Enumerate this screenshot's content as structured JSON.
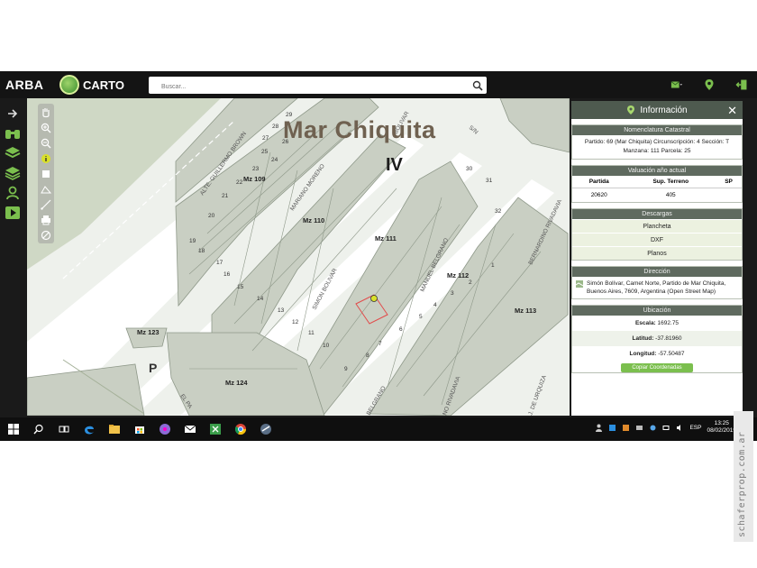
{
  "app": {
    "brand": "ARBA",
    "product": "CARTO",
    "search_placeholder": "Buscar..."
  },
  "map": {
    "title": "Mar Chiquita",
    "subtitle": "IV",
    "street_labels": [
      "ALTE. GUILLERMO BROWN",
      "MARIANO MORENO",
      "SIMON BOLIVAR",
      "MANUEL BELGRANO",
      "BERNARDINO RIVADAVIA",
      "EL PA",
      "S/N",
      "BELGRANO",
      "NO RIVADAVIA",
      "J. DE URQUIZA",
      "BOLIVAR"
    ],
    "block_labels": [
      "Mz 109",
      "Mz 110",
      "Mz 111",
      "Mz 112",
      "Mz 113",
      "Mz 123",
      "Mz 124"
    ],
    "zone_label": "P",
    "parcel_numbers": [
      "29",
      "28",
      "27",
      "26",
      "25",
      "24",
      "23",
      "22",
      "21",
      "20",
      "19",
      "18",
      "17",
      "16",
      "15",
      "14",
      "13",
      "12",
      "11",
      "10",
      "9",
      "8",
      "7",
      "6",
      "5",
      "4",
      "3",
      "2",
      "1",
      "31",
      "30",
      "32"
    ]
  },
  "panel": {
    "header": "Información",
    "nomenclatura": {
      "title": "Nomenclatura Catastral",
      "text": "Partido: 69 (Mar Chiquita) Circunscripción: 4 Sección: T Manzana: 111 Parcela: 25"
    },
    "valuacion": {
      "title": "Valuación año actual",
      "headers": [
        "Partida",
        "Sup. Terreno",
        "SP"
      ],
      "row": [
        "20620",
        "405",
        ""
      ]
    },
    "descargas": {
      "title": "Descargas",
      "items": [
        "Plancheta",
        "DXF",
        "Planos"
      ]
    },
    "direccion": {
      "title": "Dirección",
      "text": "Simón Bolívar, Camet Norte, Partido de Mar Chiquita, Buenos Aires, 7609, Argentina (Open Street Map)"
    },
    "ubicacion": {
      "title": "Ubicación",
      "rows": [
        {
          "label": "Escala:",
          "value": "1692.75"
        },
        {
          "label": "Latitud:",
          "value": "-37.81960"
        },
        {
          "label": "Longitud:",
          "value": "-57.50487"
        }
      ],
      "button": "Copiar Coordenadas"
    }
  },
  "taskbar": {
    "language": "ESP",
    "time": "13:25",
    "date": "08/02/2019"
  },
  "watermark": "schaferprop.com.ar",
  "colors": {
    "appbar": "#141414",
    "panel_header": "#4e5a4f",
    "accent_green": "#7bbf4e",
    "parcel_fill": "#c9cfc3",
    "road": "#ffffff"
  }
}
